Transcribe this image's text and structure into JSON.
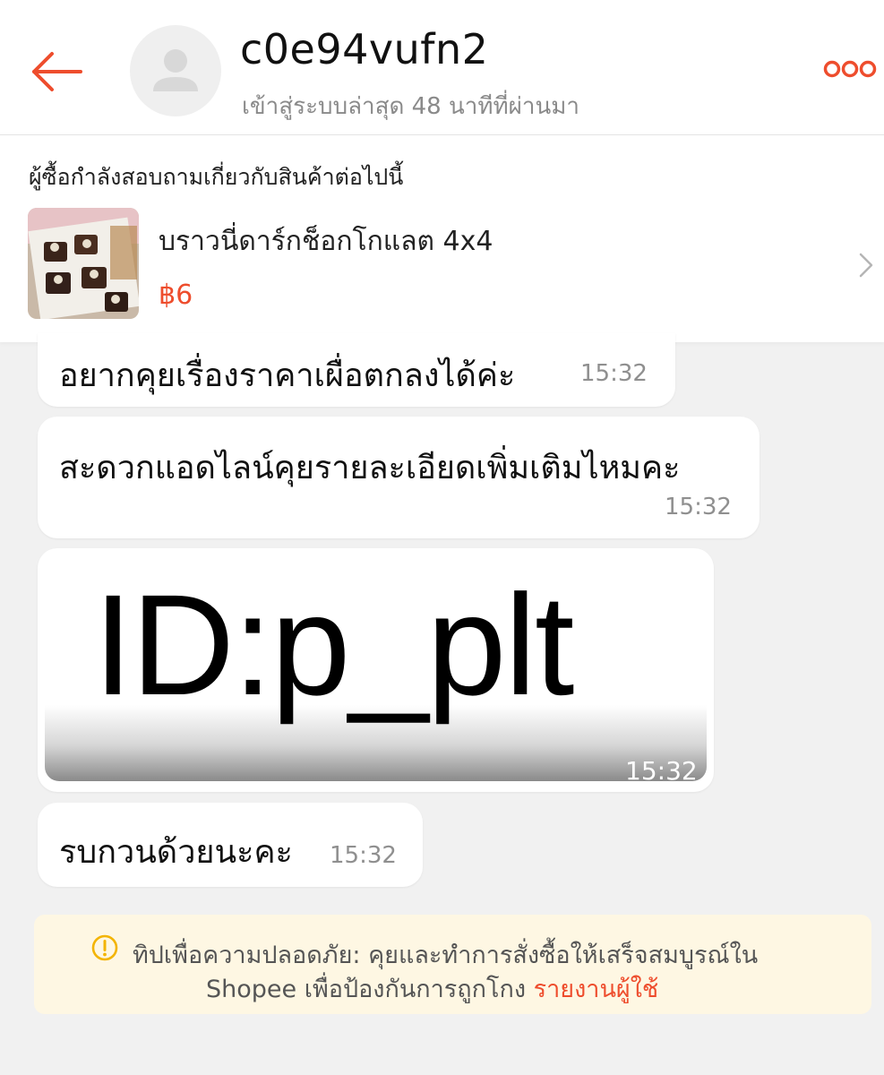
{
  "header": {
    "username": "c0e94vufn2",
    "last_seen": "เข้าสู่ระบบล่าสุด 48 นาทีที่ผ่านมา",
    "back_icon": "back-arrow-icon",
    "more_icon": "more-dots-icon",
    "accent_color": "#ee4d2d"
  },
  "product": {
    "notice": "ผู้ซื้อกำลังสอบถามเกี่ยวกับสินค้าต่อไปนี้",
    "name": "บราวนี่ดาร์กช็อกโกแลต 4x4",
    "price": "฿6",
    "chevron_icon": "chevron-right-icon"
  },
  "messages": [
    {
      "text": "อยากคุยเรื่องราคาเผื่อตกลงได้ค่ะ",
      "time": "15:32"
    },
    {
      "text": "สะดวกแอดไลน์คุยรายละเอียดเพิ่มเติมไหมคะ",
      "time": "15:32"
    },
    {
      "image_text": "ID:p_plt",
      "time": "15:32"
    },
    {
      "text": "รบกวนด้วยนะคะ",
      "time": "15:32"
    }
  ],
  "safety_tip": {
    "line1": "ทิปเพื่อความปลอดภัย: คุยและทำการสั่งซื้อให้เสร็จสมบูรณ์ใน",
    "line2": "Shopee เพื่อป้องกันการถูกโกง",
    "report_link": "รายงานผู้ใช้",
    "icon": "warning-icon",
    "background_color": "#fef7e3"
  }
}
